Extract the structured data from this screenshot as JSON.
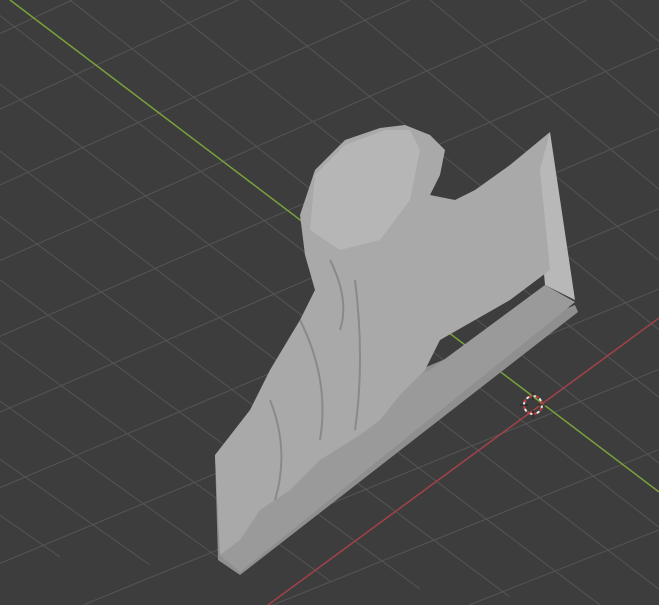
{
  "viewport": {
    "background": "#3d3d3d",
    "grid_color": "#535353",
    "x_axis_color": "#a3414a",
    "y_axis_color": "#7aa13a",
    "model_color": "#a9a9a9",
    "cursor_icon": "3d-cursor-icon"
  }
}
